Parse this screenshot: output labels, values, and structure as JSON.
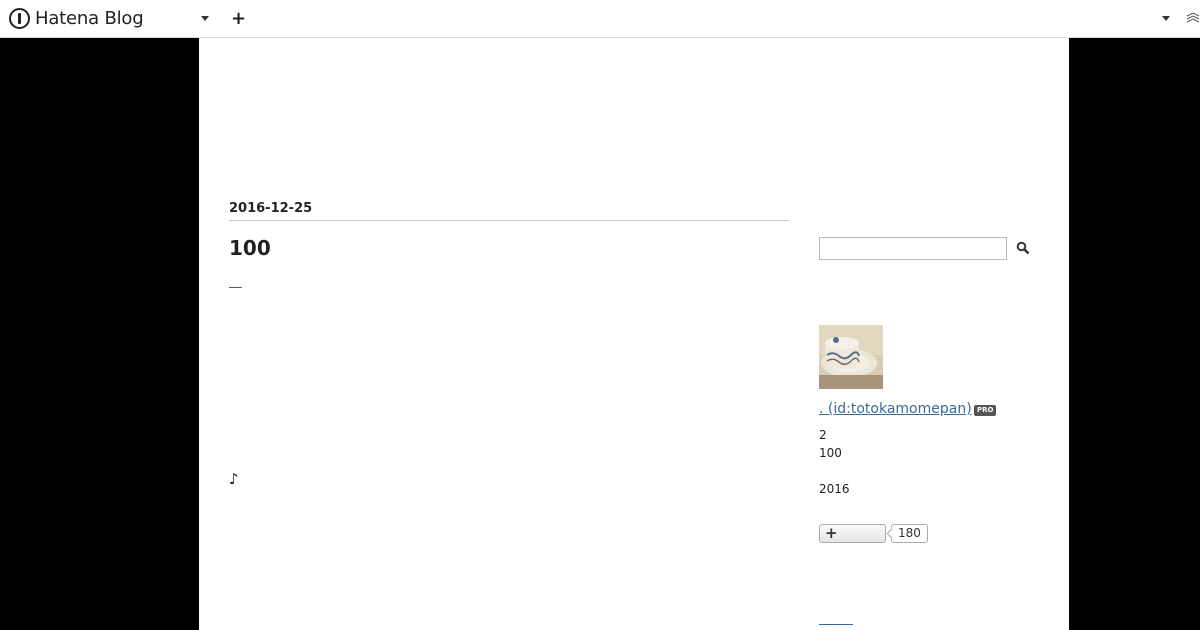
{
  "header": {
    "brand": "Hatena Blog",
    "icons": [
      "hatena-logo-icon",
      "chevron-down-icon",
      "plus-icon",
      "chevron-down-icon",
      "notification-icon"
    ]
  },
  "entry": {
    "date": "2016-12-25",
    "title": "100",
    "note": "♪"
  },
  "sidebar": {
    "search": {
      "placeholder": "",
      "value": ""
    },
    "profile": {
      "name_link": ". (id:totokamomepan)",
      "badge": "PRO",
      "stats": [
        "2",
        "100",
        "2016"
      ]
    },
    "follow": {
      "count": "180"
    }
  },
  "colors": {
    "link": "#3a6a9a",
    "background": "#000000",
    "content_bg": "#ffffff"
  }
}
